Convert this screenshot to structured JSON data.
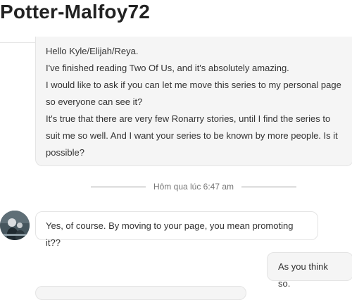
{
  "header": {
    "title": "Potter-Malfoy72"
  },
  "conversation": {
    "first_message": {
      "lines": [
        "Hello Kyle/Elijah/Reya.",
        "I've finished reading Two Of Us, and it's absolutely amazing.",
        "I would like to ask if you can let me move this series to my personal page",
        "so everyone can see it?",
        "It's true that there are very few Ronarry stories, until I find the series to",
        "suit me so well. And I want your series to be known by more people. Is it",
        "possible?"
      ]
    },
    "timestamp": "Hôm qua lúc 6:47 am",
    "reply_message": "Yes, of course. By moving to your page, you mean promoting it??",
    "own_message": "As you think so."
  }
}
